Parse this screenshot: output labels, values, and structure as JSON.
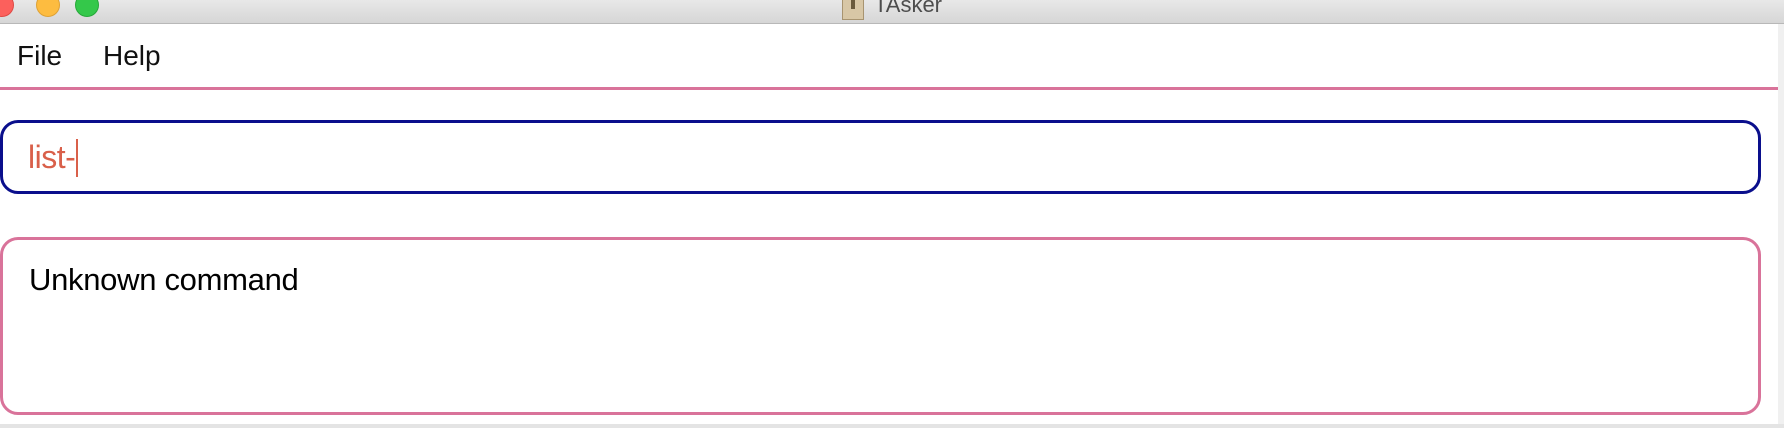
{
  "window": {
    "title": "TAsker"
  },
  "menubar": {
    "items": [
      {
        "label": "File"
      },
      {
        "label": "Help"
      }
    ]
  },
  "command_box": {
    "value": "list-"
  },
  "result_display": {
    "text": "Unknown command"
  },
  "colors": {
    "accent_pink": "#d9739a",
    "command_border": "#0a0f8c",
    "command_text": "#d9604a"
  },
  "icons": {
    "title_icon": "document-icon"
  }
}
